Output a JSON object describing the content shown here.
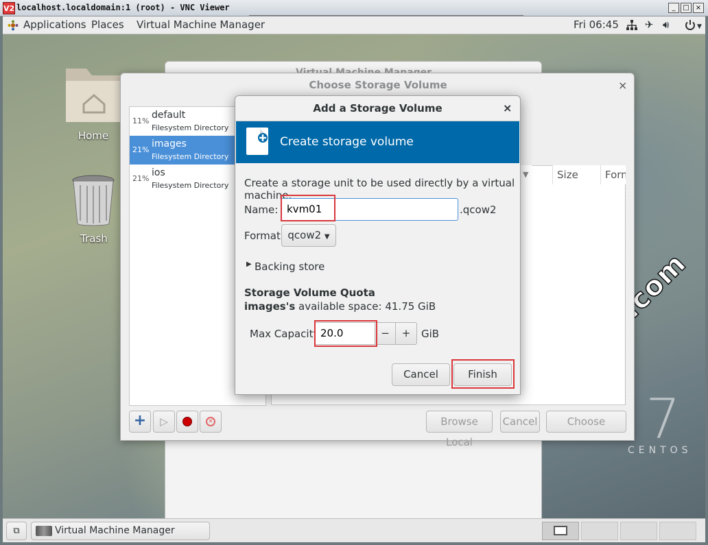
{
  "vnc": {
    "title": "localhost.localdomain:1 (root) - VNC Viewer",
    "logo": "V2",
    "buttons": [
      "_",
      "□",
      "×"
    ]
  },
  "topbar": {
    "applications": "Applications",
    "places": "Places",
    "app_menu": "Virtual Machine Manager",
    "clock": "Fri 06:45",
    "tray_icons": [
      "network-icon",
      "airplane-icon",
      "volume-icon",
      "power-icon"
    ]
  },
  "desktop": {
    "home_label": "Home",
    "trash_label": "Trash",
    "centos_number": "7",
    "centos_text": "CENTOS",
    "watermark": "bndstone.com"
  },
  "back_window": {
    "title": "Virtual Machine Manager"
  },
  "choose": {
    "title": "Choose Storage Volume",
    "close": "×",
    "pools": [
      {
        "pct": "11%",
        "name": "default",
        "type": "Filesystem Directory"
      },
      {
        "pct": "21%",
        "name": "images",
        "type": "Filesystem Directory"
      },
      {
        "pct": "21%",
        "name": "ios",
        "type": "Filesystem Directory"
      }
    ],
    "columns": {
      "size": "Size",
      "format": "Form"
    },
    "buttons": {
      "browse_local": "Browse Local",
      "cancel": "Cancel",
      "choose_volume": "Choose Volume"
    },
    "toolbar": {
      "add": "+",
      "start": "▷"
    }
  },
  "dialog": {
    "title": "Add a Storage Volume",
    "close": "×",
    "banner": "Create storage volume",
    "description": "Create a storage unit to be used directly by a virtual machine.",
    "name_label": "Name:",
    "name_value": "kvm01",
    "name_suffix": ".qcow2",
    "format_label": "Format:",
    "format_value": "qcow2",
    "backing_store": "Backing store",
    "quota_heading": "Storage Volume Quota",
    "quota_pool": "images's",
    "quota_text": "available space: 41.75 GiB",
    "capacity_label": "Max Capacity:",
    "capacity_value": "20.0",
    "capacity_unit": "GiB",
    "minus": "−",
    "plus": "+",
    "cancel": "Cancel",
    "finish": "Finish"
  },
  "taskbar": {
    "task_label": "Virtual Machine Manager"
  }
}
